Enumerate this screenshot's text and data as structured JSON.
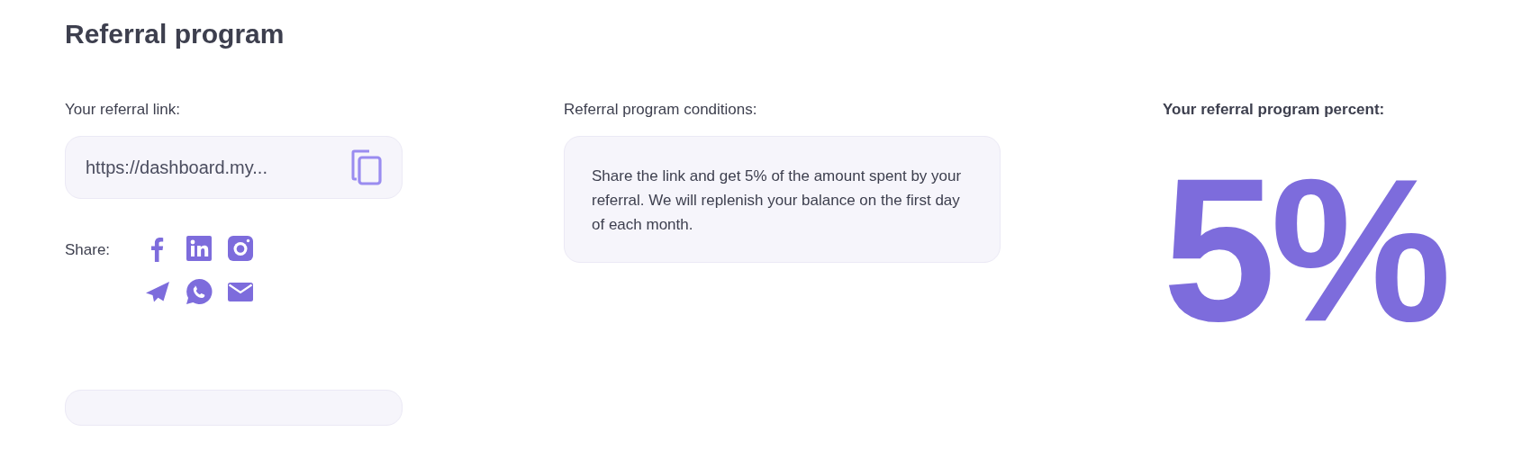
{
  "page_title": "Referral program",
  "referral_link": {
    "label": "Your referral link:",
    "value": "https://dashboard.my..."
  },
  "share": {
    "label": "Share:"
  },
  "conditions": {
    "label": "Referral program conditions:",
    "text": "Share the link and get 5% of the amount spent by your referral. We will replenish your balance on the first day of each month."
  },
  "percent": {
    "label": "Your referral program percent:",
    "value": "5%"
  }
}
